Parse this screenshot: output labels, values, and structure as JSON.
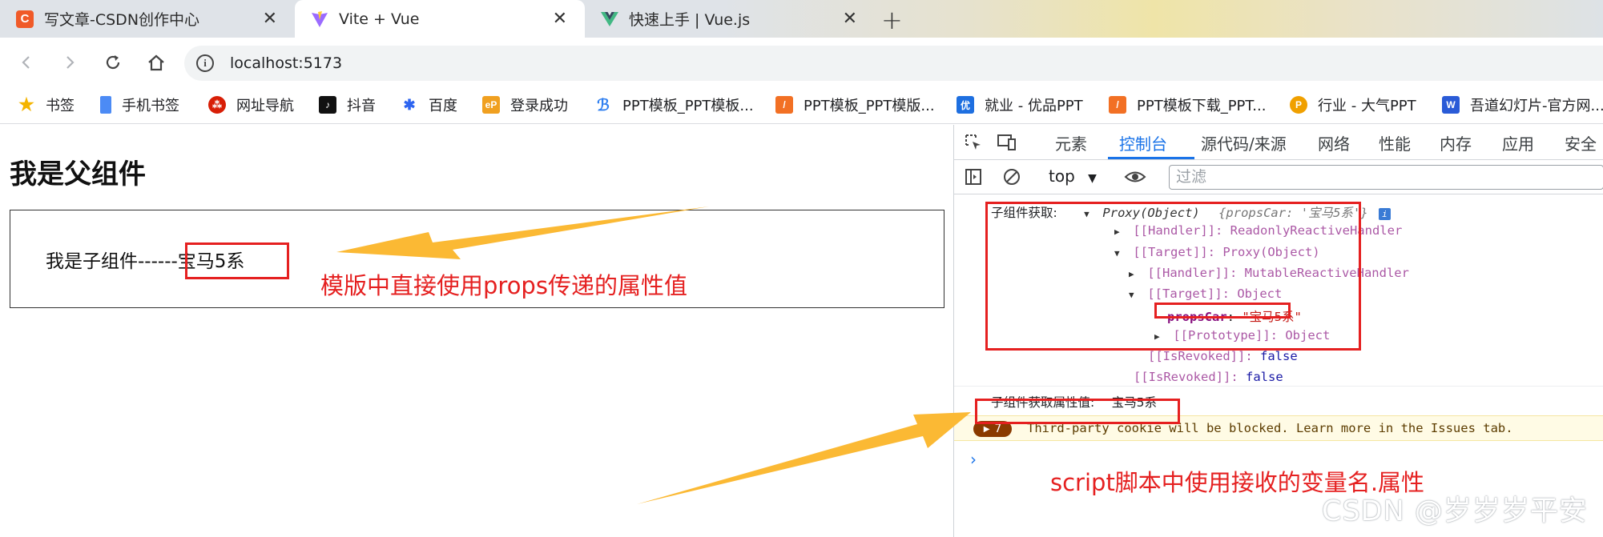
{
  "browser": {
    "tabs": [
      {
        "title": "写文章-CSDN创作中心",
        "icon": "csdn-icon",
        "favicon_letter": "C",
        "active": false
      },
      {
        "title": "Vite + Vue",
        "icon": "vite-icon",
        "active": true
      },
      {
        "title": "快速上手 | Vue.js",
        "icon": "vue-icon",
        "active": false
      }
    ],
    "new_tab_symbol": "+",
    "close_symbol": "✕",
    "address": "localhost:5173",
    "bookmarks": [
      {
        "label": "书签",
        "icon": "star-icon"
      },
      {
        "label": "手机书签",
        "icon": "phone-icon"
      },
      {
        "label": "网址导航",
        "icon": "nav-icon"
      },
      {
        "label": "抖音",
        "icon": "douyin-icon"
      },
      {
        "label": "百度",
        "icon": "baidu-icon"
      },
      {
        "label": "登录成功",
        "icon": "ep-icon"
      },
      {
        "label": "PPT模板_PPT模板...",
        "icon": "ppt-icon"
      },
      {
        "label": "PPT模板_PPT模版...",
        "icon": "ppt-icon"
      },
      {
        "label": "就业 - 优品PPT",
        "icon": "youpin-icon"
      },
      {
        "label": "PPT模板下载_PPT...",
        "icon": "ppt-icon"
      },
      {
        "label": "行业 - 大气PPT",
        "icon": "daqi-icon"
      },
      {
        "label": "吾道幻灯片-官方网...",
        "icon": "wudao-icon"
      }
    ]
  },
  "page": {
    "title": "我是父组件",
    "child_prefix": "我是子组件------",
    "child_value": "宝马5系",
    "annotation_template": "模版中直接使用props传递的属性值",
    "annotation_script": "script脚本中使用接收的变量名.属性"
  },
  "devtools": {
    "tabs": [
      "元素",
      "控制台",
      "源代码/来源",
      "网络",
      "性能",
      "内存",
      "应用",
      "安全"
    ],
    "active_tab": "控制台",
    "context": "top",
    "filter_placeholder": "过滤",
    "console": {
      "log1_label": "子组件获取:",
      "log1_proxy": "Proxy(Object)",
      "log1_preview": "{propsCar: '宝马5系'}",
      "info_badge": "i",
      "handler1": "[[Handler]]: ReadonlyReactiveHandler",
      "target1": "[[Target]]: Proxy(Object)",
      "handler2": "[[Handler]]: MutableReactiveHandler",
      "target2": "[[Target]]: Object",
      "props_key": "propsCar",
      "props_value": "\"宝马5系\"",
      "prototype": "[[Prototype]]: Object",
      "isrevoked_label": "[[IsRevoked]]:",
      "isrevoked_value": "false",
      "log2_label": "子组件获取属性值:",
      "log2_value": "宝马5系",
      "warn_count": "7",
      "warn_text": "Third-party cookie will be blocked. Learn more in the Issues tab.",
      "prompt": "›"
    }
  },
  "watermark": "CSDN @岁岁岁平安",
  "colors": {
    "annotation": "#e52020",
    "arrow": "#fbb934",
    "active_tab": "#1a73e8"
  }
}
